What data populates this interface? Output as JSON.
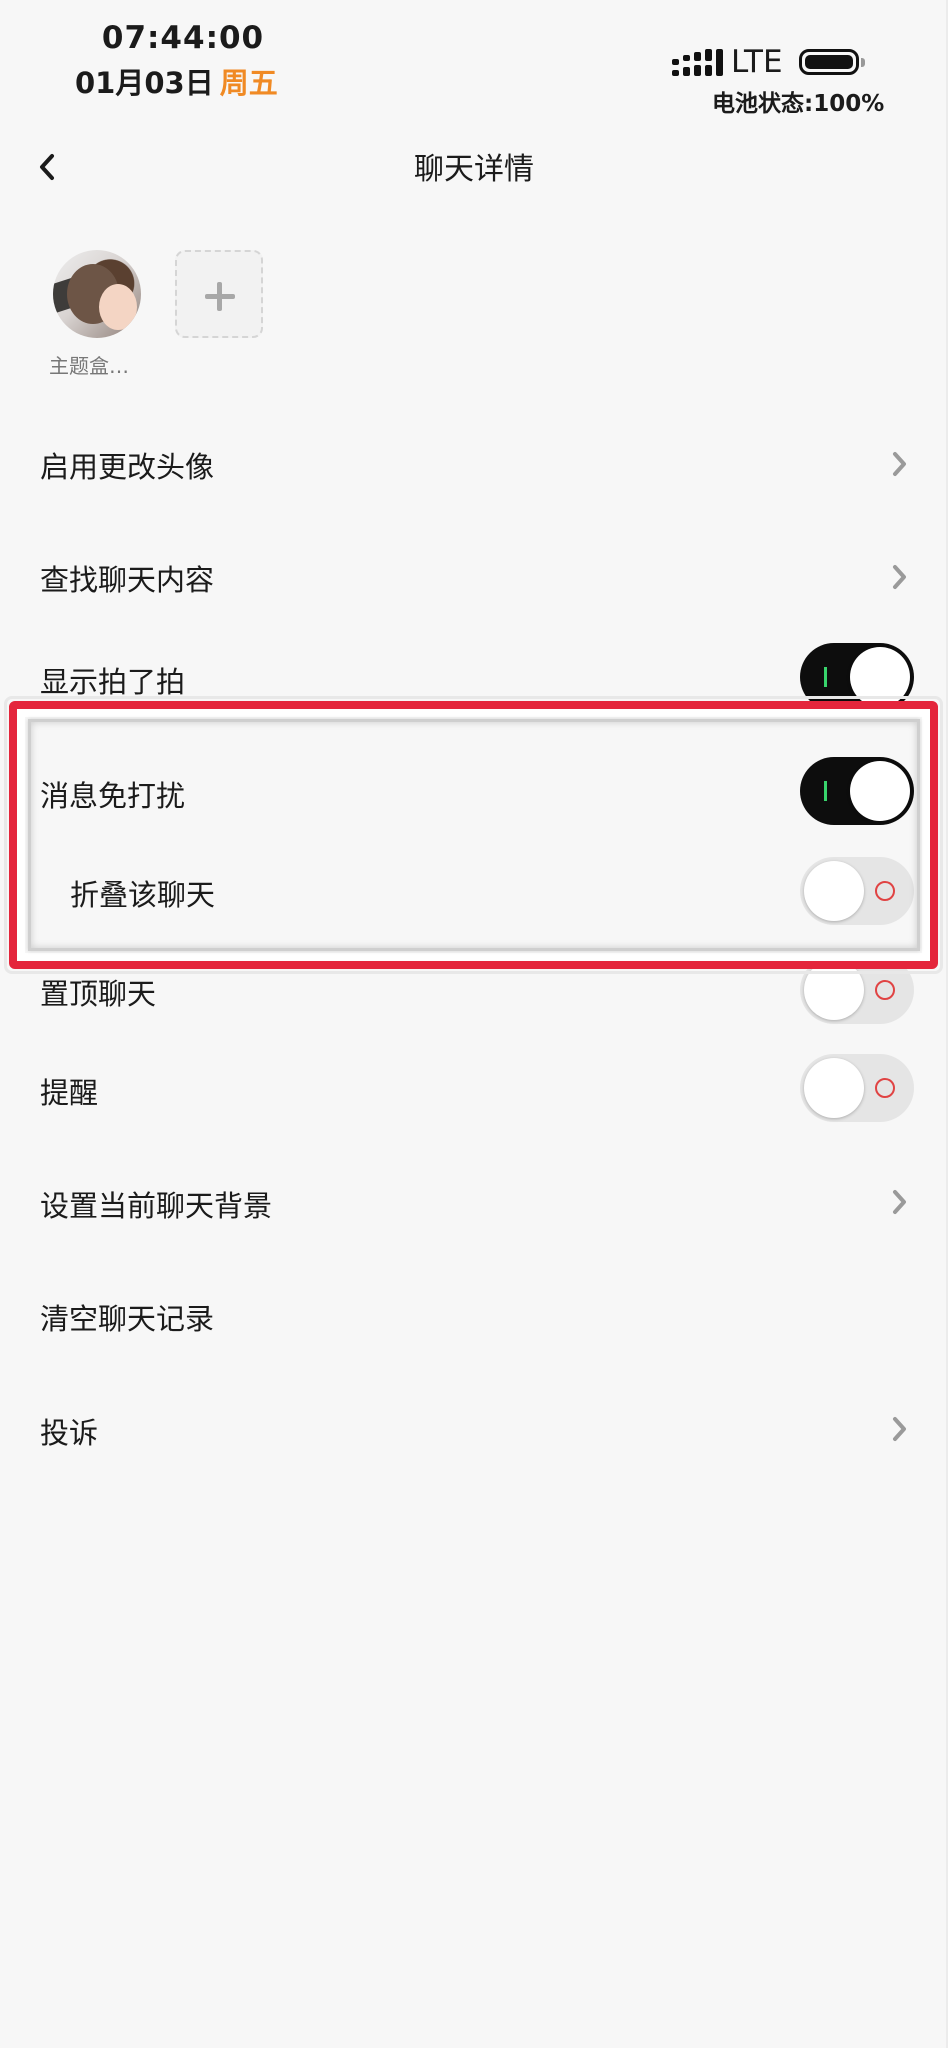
{
  "status_bar": {
    "time": "07:44:00",
    "date": "01月03日",
    "weekday": "周五",
    "network": "LTE",
    "battery_text": "电池状态:100%",
    "battery_level": 100
  },
  "header": {
    "title": "聊天详情",
    "back_icon": "chevron-left-icon"
  },
  "members": [
    {
      "name": "主题盒…"
    }
  ],
  "add_member_icon": "plus-icon",
  "settings": {
    "change_avatar": {
      "label": "启用更改头像",
      "icon": "chevron-right-icon"
    },
    "search_chat": {
      "label": "查找聊天内容",
      "icon": "chevron-right-icon"
    },
    "show_pat": {
      "label": "显示拍了拍",
      "enabled": true
    },
    "mute": {
      "label": "消息免打扰",
      "enabled": true
    },
    "fold_chat": {
      "label": "折叠该聊天",
      "enabled": false
    },
    "pin_chat": {
      "label": "置顶聊天",
      "enabled": false
    },
    "remind": {
      "label": "提醒",
      "enabled": false
    },
    "chat_background": {
      "label": "设置当前聊天背景",
      "icon": "chevron-right-icon"
    },
    "clear_history": {
      "label": "清空聊天记录"
    },
    "report": {
      "label": "投诉",
      "icon": "chevron-right-icon"
    }
  },
  "colors": {
    "weekday": "#f08a24",
    "highlight_border": "#e4263c",
    "toggle_on": "#0d0d0d",
    "toggle_off": "#e5e5e5",
    "on_mark": "#38d46c",
    "off_mark": "#e04343"
  }
}
